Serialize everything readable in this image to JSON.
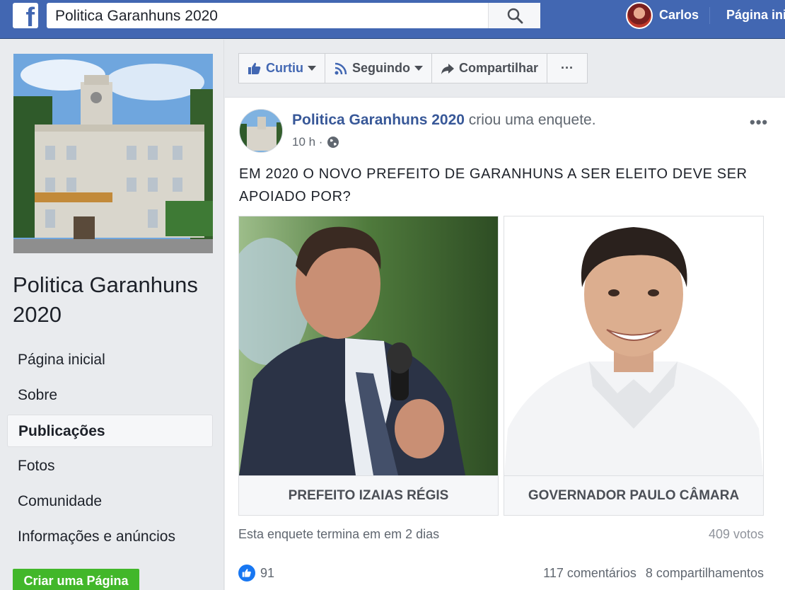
{
  "topbar": {
    "search_value": "Politica Garanhuns 2020",
    "user_name": "Carlos",
    "home_label": "Página inicial"
  },
  "sidebar": {
    "page_title": "Politica Garanhuns 2020",
    "items": [
      {
        "label": "Página inicial",
        "active": false
      },
      {
        "label": "Sobre",
        "active": false
      },
      {
        "label": "Publicações",
        "active": true
      },
      {
        "label": "Fotos",
        "active": false
      },
      {
        "label": "Comunidade",
        "active": false
      },
      {
        "label": "Informações e anúncios",
        "active": false
      }
    ],
    "create_page_label": "Criar uma Página"
  },
  "actions": {
    "liked_label": "Curtiu",
    "following_label": "Seguindo",
    "share_label": "Compartilhar",
    "more_label": "···"
  },
  "post": {
    "page_name": "Politica Garanhuns 2020",
    "verb": "criou uma enquete.",
    "time": "10 h ·",
    "menu": "•••",
    "question": "EM 2020 O NOVO PREFEITO DE GARANHUNS A SER ELEITO DEVE SER APOIADO POR?",
    "options": [
      {
        "label": "PREFEITO IZAIAS RÉGIS"
      },
      {
        "label": "GOVERNADOR PAULO CÂMARA"
      }
    ],
    "poll_end": "Esta enquete termina em em 2 dias",
    "votes": "409 votos",
    "like_count": "91",
    "comments": "117 comentários",
    "shares": "8 compartilhamentos"
  },
  "colors": {
    "brand": "#4267b2",
    "link": "#385898",
    "create_button": "#42b72a",
    "like": "#1877f2"
  }
}
